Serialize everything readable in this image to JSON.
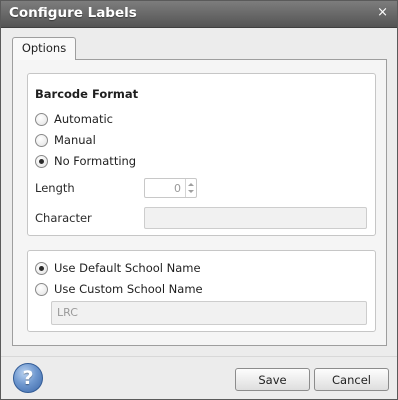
{
  "window": {
    "title": "Configure Labels",
    "close_glyph": "×"
  },
  "tabs": [
    {
      "label": "Options",
      "selected": true
    }
  ],
  "barcode_format": {
    "heading": "Barcode Format",
    "options": [
      {
        "label": "Automatic",
        "checked": false
      },
      {
        "label": "Manual",
        "checked": false
      },
      {
        "label": "No Formatting",
        "checked": true
      }
    ],
    "length": {
      "label": "Length",
      "value": "0"
    },
    "character": {
      "label": "Character",
      "value": ""
    }
  },
  "school_name": {
    "options": [
      {
        "label": "Use Default School Name",
        "checked": true
      },
      {
        "label": "Use Custom School Name",
        "checked": false
      }
    ],
    "custom_value": "LRC"
  },
  "footer": {
    "help_glyph": "?",
    "save_label": "Save",
    "cancel_label": "Cancel"
  },
  "colors": {
    "titlebar": "#5f5f5f",
    "title_text": "#ffffff",
    "help_icon": "#3b67a8"
  },
  "icons": {
    "close": "close-icon",
    "help": "help-icon",
    "spinner_up": "spinner-up-icon",
    "spinner_down": "spinner-down-icon"
  }
}
